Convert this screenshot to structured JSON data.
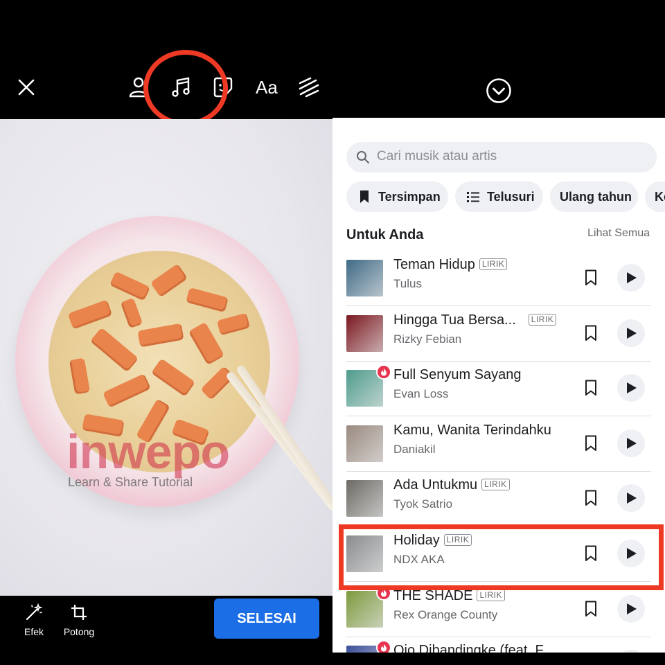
{
  "left_panel": {
    "toolbar": {
      "close_icon": "close-icon",
      "tools": [
        "person-tag-icon",
        "music-note-icon",
        "sticker-icon",
        "text-tool",
        "draw-icon"
      ],
      "text_tool_label": "Aa"
    },
    "photo": {
      "watermark_logo": "inwepo",
      "watermark_tagline": "Learn & Share Tutorial"
    },
    "bottom_bar": {
      "effects_label": "Efek",
      "crop_label": "Potong",
      "done_label": "SELESAI"
    },
    "highlight_color": "#ee3a24"
  },
  "right_panel": {
    "collapse_icon": "chevron-down-circle-icon",
    "search": {
      "placeholder": "Cari musik atau artis"
    },
    "chips": [
      "Tersimpan",
      "Telusuri",
      "Ulang tahun",
      "Ke"
    ],
    "section": {
      "title": "Untuk Anda",
      "see_all": "Lihat Semua"
    },
    "tracks": [
      {
        "title": "Teman Hidup",
        "artist": "Tulus",
        "lyrics_badge": "LIRIK",
        "trending": false,
        "thumb_color": "#3f6a86"
      },
      {
        "title": "Hingga Tua Bersa...",
        "artist": "Rizky Febian",
        "lyrics_badge": "LIRIK",
        "trending": false,
        "thumb_color": "#7b1820"
      },
      {
        "title": "Full Senyum Sayang",
        "artist": "Evan Loss",
        "lyrics_badge": "",
        "trending": true,
        "thumb_color": "#4e9c8c"
      },
      {
        "title": "Kamu, Wanita Terindahku",
        "artist": "Daniakil",
        "lyrics_badge": "",
        "trending": false,
        "thumb_color": "#9a8a80"
      },
      {
        "title": "Ada Untukmu",
        "artist": "Tyok Satrio",
        "lyrics_badge": "LIRIK",
        "trending": false,
        "thumb_color": "#6d6a64"
      },
      {
        "title": "Holiday",
        "artist": "NDX AKA",
        "lyrics_badge": "LIRIK",
        "trending": false,
        "thumb_color": "#8a8c8e"
      },
      {
        "title": "THE SHADE",
        "artist": "Rex Orange County",
        "lyrics_badge": "LIRIK",
        "trending": true,
        "thumb_color": "#7d9a3e"
      },
      {
        "title": "Ojo Dibandingke (feat. F",
        "artist": "",
        "lyrics_badge": "",
        "trending": true,
        "thumb_color": "#3b4f9a"
      }
    ],
    "accent_color": "#1b6ee6"
  }
}
